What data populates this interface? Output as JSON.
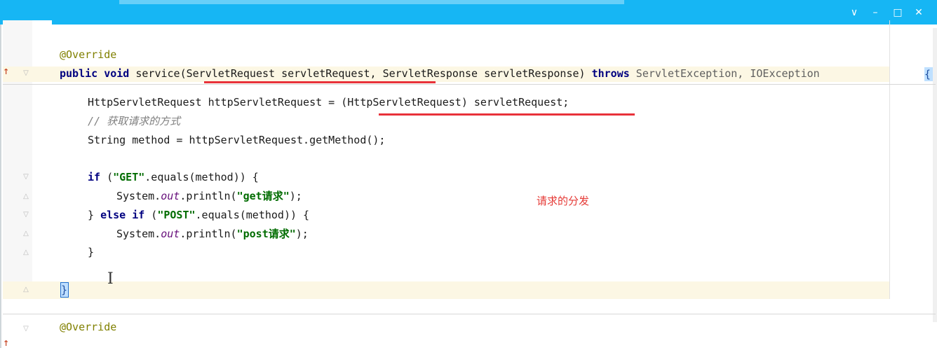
{
  "window": {
    "controls": [
      "∨",
      "–",
      "□",
      "✕"
    ],
    "titlebar_color": "#16b6f4"
  },
  "code": {
    "annotation_override": "@Override",
    "kw_public": "public",
    "kw_void": "void",
    "method_sig": " service(ServletRequest servletRequest, ServletResponse servletResponse) ",
    "kw_throws": "throws",
    "throws_list": " ServletException, IOException",
    "cast_line": "HttpServletRequest httpServletRequest = (HttpServletRequest) servletRequest;",
    "comment_method": "// 获取请求的方式",
    "get_method_line": "String method = httpServletRequest.getMethod();",
    "kw_if": "if",
    "if_open": " (",
    "str_get": "\"GET\"",
    "if_rest": ".equals(method)) {",
    "sysout1_pre": "System.",
    "field_out": "out",
    "println_open": ".println(",
    "str_get_req": "\"get请求\"",
    "println_close": ");",
    "close_brace_else": "} ",
    "kw_else": "else",
    "kw_if2": "if",
    "str_post": "\"POST\"",
    "str_post_req": "\"post请求\"",
    "close_brace": "}",
    "method_close_brace": "}",
    "override_2": "@Override"
  },
  "annotation_note": "请求的分发",
  "colors": {
    "keyword": "#000080",
    "annotation": "#808000",
    "comment": "#808080",
    "string": "#006c00",
    "field": "#660e7a",
    "underline": "#e8323a",
    "note": "#e53935",
    "current_line": "#fcf7e4"
  }
}
